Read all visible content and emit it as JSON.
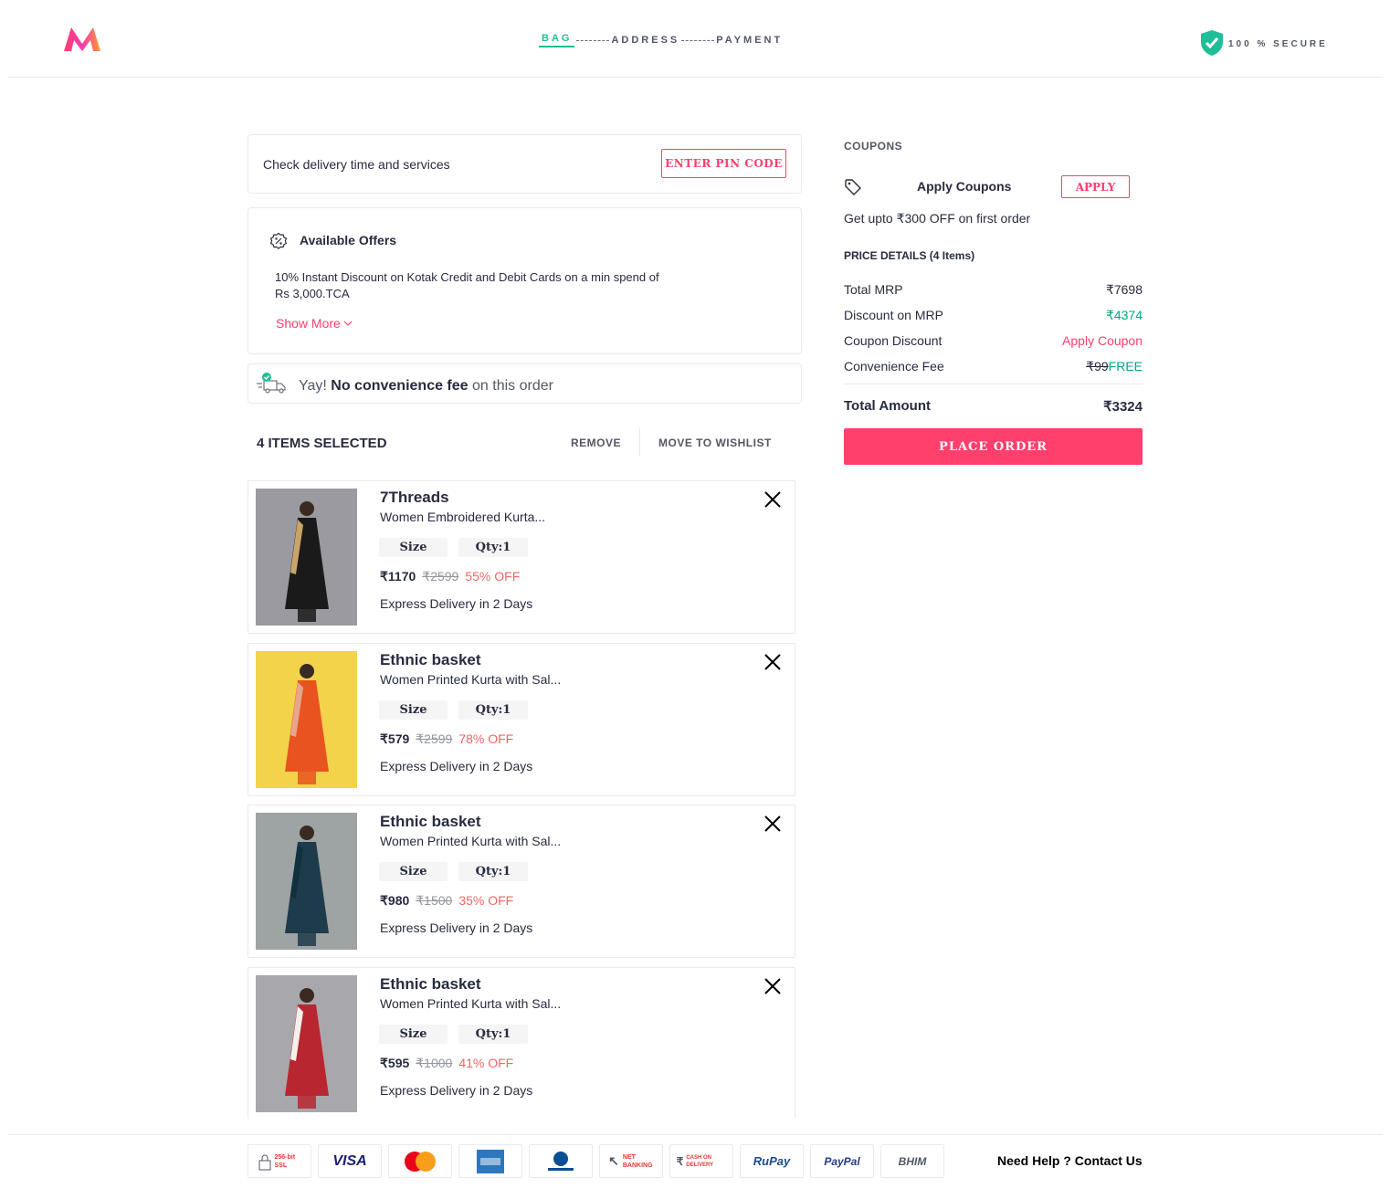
{
  "header": {
    "steps": [
      "BAG",
      "ADDRESS",
      "PAYMENT"
    ],
    "secure_text": "100 % SECURE"
  },
  "pincode": {
    "text": "Check delivery time and services",
    "button": "ENTER PIN CODE"
  },
  "offers": {
    "title": "Available Offers",
    "body": "10% Instant Discount on Kotak Credit and Debit Cards on a min spend of Rs 3,000.TCA",
    "show_more": "Show More"
  },
  "fee_banner": {
    "prefix": "Yay!",
    "bold": "No convenience fee",
    "suffix": "on this order"
  },
  "selection": {
    "title": "4 ITEMS SELECTED",
    "remove": "REMOVE",
    "wishlist": "MOVE TO WISHLIST"
  },
  "items": [
    {
      "brand": "7Threads",
      "name": "Women Embroidered Kurta...",
      "size": "Size",
      "qty": "Qty:1",
      "price": "₹1170",
      "mrp": "₹2599",
      "off": "55% OFF",
      "delivery": "Express Delivery in 2 Days",
      "colors": [
        "#9a9aa0",
        "#1a1a1a",
        "#c9a56a"
      ]
    },
    {
      "brand": "Ethnic basket",
      "name": "Women Printed Kurta with Sal...",
      "size": "Size",
      "qty": "Qty:1",
      "price": "₹579",
      "mrp": "₹2599",
      "off": "78% OFF",
      "delivery": "Express Delivery in 2 Days",
      "colors": [
        "#f2d34a",
        "#e8531f",
        "#e8a58e"
      ]
    },
    {
      "brand": "Ethnic basket",
      "name": "Women Printed Kurta with Sal...",
      "size": "Size",
      "qty": "Qty:1",
      "price": "₹980",
      "mrp": "₹1500",
      "off": "35% OFF",
      "delivery": "Express Delivery in 2 Days",
      "colors": [
        "#9ea3a4",
        "#1d3b4a",
        "#13303f"
      ]
    },
    {
      "brand": "Ethnic basket",
      "name": "Women Printed Kurta with Sal...",
      "size": "Size",
      "qty": "Qty:1",
      "price": "₹595",
      "mrp": "₹1000",
      "off": "41% OFF",
      "delivery": "Express Delivery in 2 Days",
      "colors": [
        "#a8a8ac",
        "#b8262f",
        "#f4f0ec"
      ]
    }
  ],
  "coupons": {
    "heading": "COUPONS",
    "label": "Apply Coupons",
    "button": "APPLY",
    "sub": "Get upto ₹300 OFF on first order"
  },
  "price_details": {
    "heading": "PRICE DETAILS (4 Items)",
    "total_mrp_label": "Total MRP",
    "total_mrp": "₹7698",
    "discount_label": "Discount on MRP",
    "discount": "₹4374",
    "coupon_label": "Coupon Discount",
    "coupon_value": "Apply Coupon",
    "fee_label": "Convenience Fee",
    "fee_old": "₹99",
    "fee_new": "FREE",
    "total_label": "Total Amount",
    "total": "₹3324",
    "place_order": "PLACE ORDER"
  },
  "footer": {
    "payments": [
      "256-bit SSL",
      "VISA",
      "MasterCard",
      "AMEX",
      "Diners Club",
      "NET BANKING",
      "CASH ON DELIVERY",
      "RuPay",
      "PayPal",
      "BHIM"
    ],
    "help": "Need Help ? Contact Us"
  },
  "colors": {
    "accent": "#ff3f6c",
    "green": "#03a685",
    "teal": "#20bd99"
  }
}
